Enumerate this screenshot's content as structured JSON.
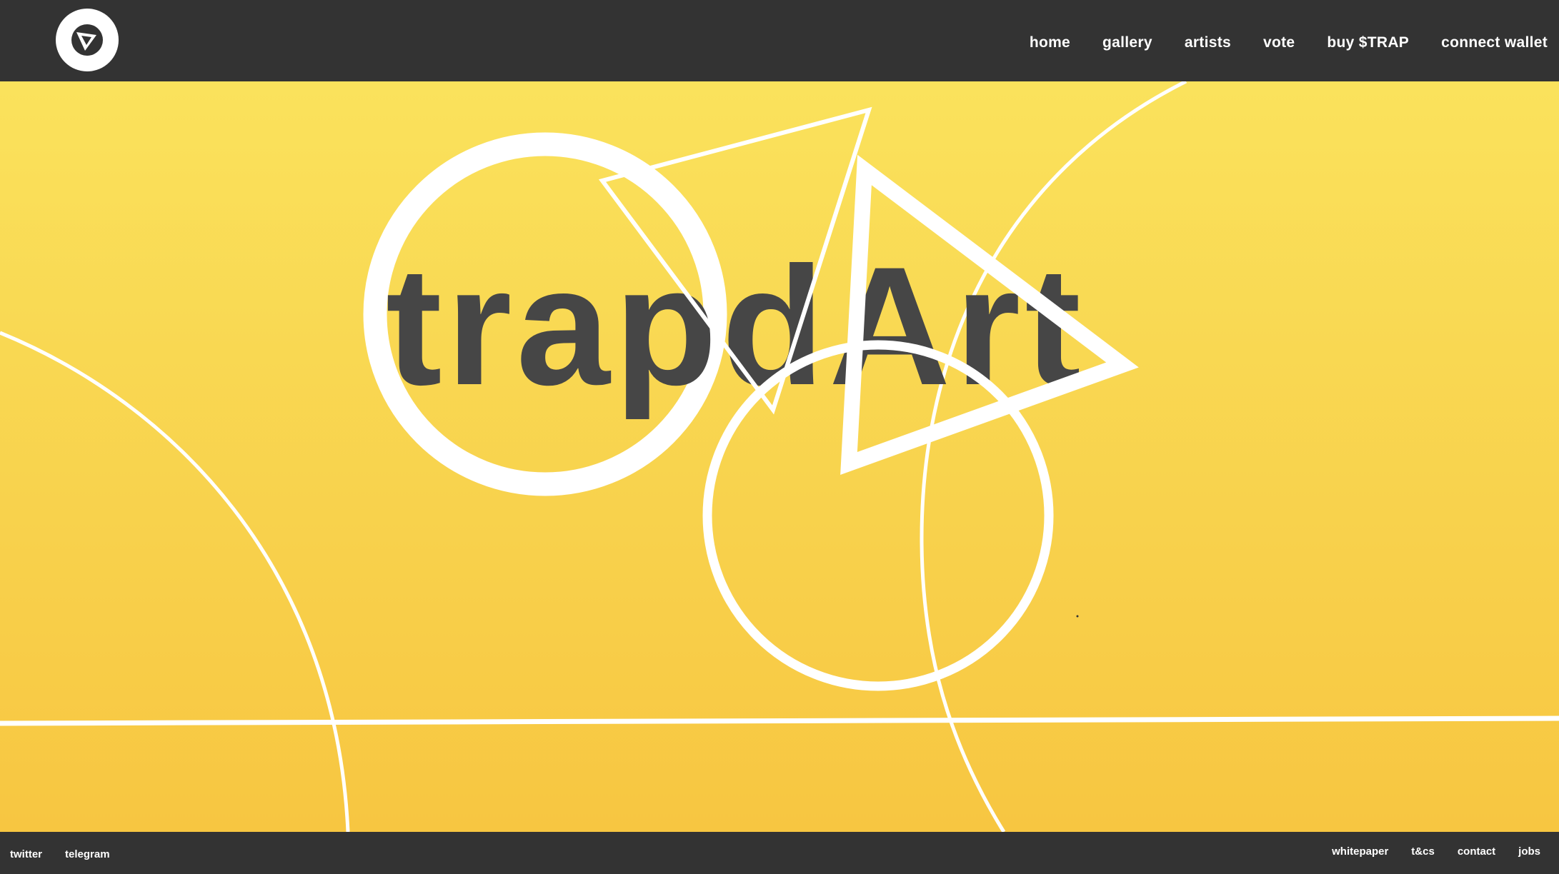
{
  "brand": {
    "logo_icon": "triangle-spiral-logo-icon",
    "hero_title": "trapdArt"
  },
  "nav": {
    "items": [
      {
        "label": "home"
      },
      {
        "label": "gallery"
      },
      {
        "label": "artists"
      },
      {
        "label": "vote"
      },
      {
        "label": "buy $TRAP"
      },
      {
        "label": "connect wallet"
      }
    ]
  },
  "footer": {
    "left": [
      {
        "label": "twitter"
      },
      {
        "label": "telegram"
      }
    ],
    "right": [
      {
        "label": "whitepaper"
      },
      {
        "label": "t&cs"
      },
      {
        "label": "contact"
      },
      {
        "label": "jobs"
      }
    ]
  },
  "colors": {
    "bar": "#333333",
    "hero_top": "#fae25c",
    "hero_bottom": "#f7c641",
    "title": "#464646",
    "lines": "#ffffff"
  }
}
